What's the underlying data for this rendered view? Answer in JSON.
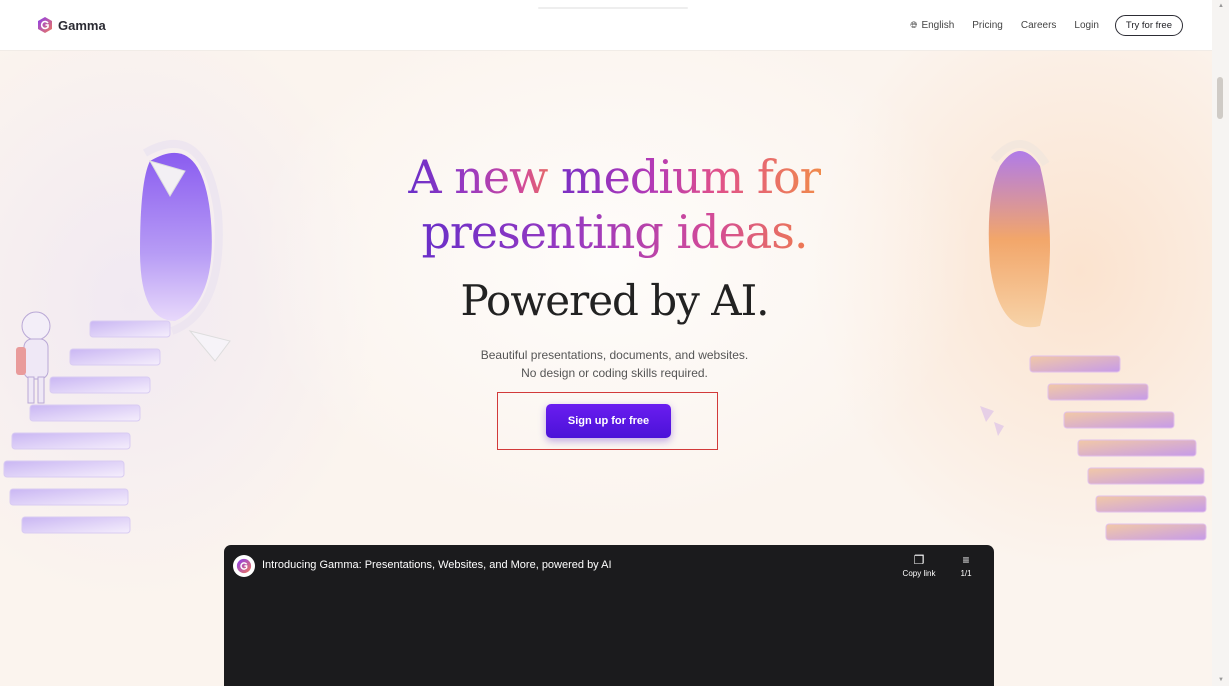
{
  "header": {
    "brand_name": "Gamma",
    "nav": {
      "language": "English",
      "pricing": "Pricing",
      "careers": "Careers",
      "login": "Login",
      "try_free": "Try for free"
    }
  },
  "hero": {
    "title_line1_plain": "A new ",
    "title_line1_grad": "medium for",
    "title_line2": "presenting ideas.",
    "title_line3": "Powered by AI.",
    "subtitle_line1": "Beautiful presentations, documents, and websites.",
    "subtitle_line2": "No design or coding skills required.",
    "cta_label": "Sign up for free"
  },
  "video": {
    "title": "Introducing Gamma: Presentations, Websites, and More, powered by AI",
    "copy_link_label": "Copy link",
    "playlist_label": "1/1"
  },
  "colors": {
    "accent": "#5a16e6",
    "highlight_box": "#d23a3a",
    "video_bg": "#1b1b1d"
  },
  "icons": {
    "brand": "gamma-logo-icon",
    "language": "globe-icon",
    "copy": "copy-icon",
    "playlist": "playlist-icon"
  }
}
